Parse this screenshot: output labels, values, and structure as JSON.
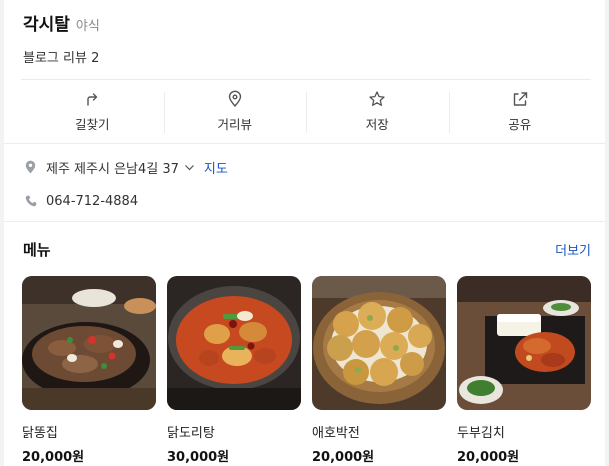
{
  "place": {
    "name": "각시탈",
    "category": "야식",
    "review_text": "블로그 리뷰 2"
  },
  "actions": [
    {
      "label": "길찾기",
      "icon": "directions-icon"
    },
    {
      "label": "거리뷰",
      "icon": "location-pin-icon"
    },
    {
      "label": "저장",
      "icon": "star-icon"
    },
    {
      "label": "공유",
      "icon": "share-icon"
    }
  ],
  "info": {
    "address": "제주 제주시 은남4길 37",
    "map_link": "지도",
    "phone": "064-712-4884"
  },
  "menu": {
    "title": "메뉴",
    "more_link": "더보기",
    "items": [
      {
        "name": "닭똥집",
        "price": "20,000원"
      },
      {
        "name": "닭도리탕",
        "price": "30,000원"
      },
      {
        "name": "애호박전",
        "price": "20,000원"
      },
      {
        "name": "두부김치",
        "price": "20,000원"
      }
    ]
  },
  "colors": {
    "link": "#1a56c4",
    "icon": "#555555",
    "divider": "#ececec"
  }
}
